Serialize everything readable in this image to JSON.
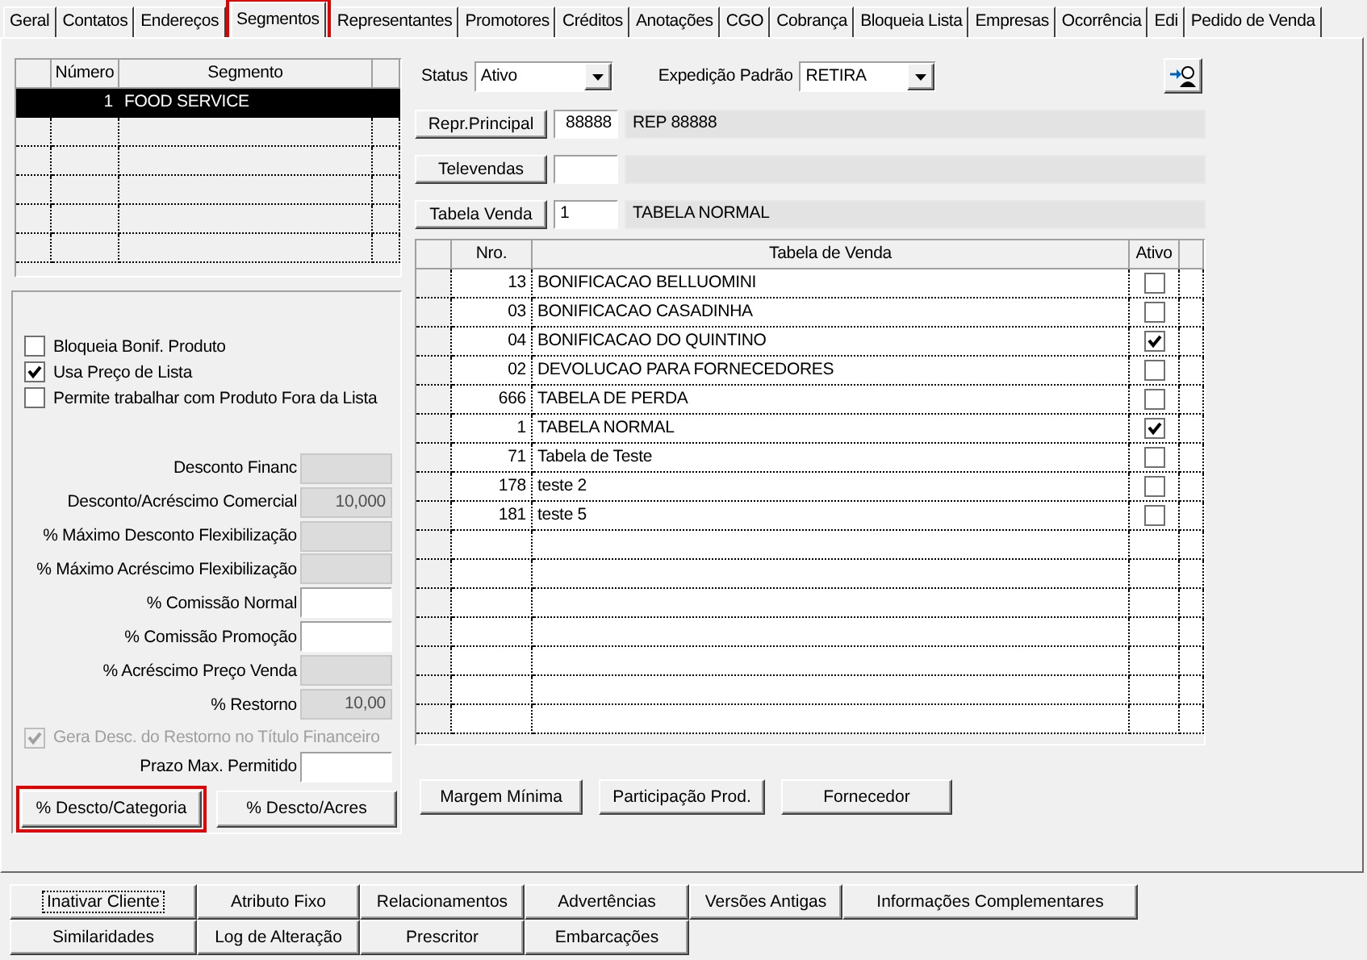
{
  "tabs": [
    {
      "label": "Geral",
      "selected": false,
      "highlighted": false
    },
    {
      "label": "Contatos",
      "selected": false,
      "highlighted": false
    },
    {
      "label": "Endereços",
      "selected": false,
      "highlighted": false
    },
    {
      "label": "Segmentos",
      "selected": true,
      "highlighted": true
    },
    {
      "label": "Representantes",
      "selected": false,
      "highlighted": false
    },
    {
      "label": "Promotores",
      "selected": false,
      "highlighted": false
    },
    {
      "label": "Créditos",
      "selected": false,
      "highlighted": false
    },
    {
      "label": "Anotações",
      "selected": false,
      "highlighted": false
    },
    {
      "label": "CGO",
      "selected": false,
      "highlighted": false
    },
    {
      "label": "Cobrança",
      "selected": false,
      "highlighted": false
    },
    {
      "label": "Bloqueia Lista",
      "selected": false,
      "highlighted": false
    },
    {
      "label": "Empresas",
      "selected": false,
      "highlighted": false
    },
    {
      "label": "Ocorrência",
      "selected": false,
      "highlighted": false
    },
    {
      "label": "Edi",
      "selected": false,
      "highlighted": false
    },
    {
      "label": "Pedido de Venda",
      "selected": false,
      "highlighted": false
    }
  ],
  "segment_grid": {
    "columns": [
      "Número",
      "Segmento"
    ],
    "rows": [
      {
        "numero": "1",
        "segmento": "FOOD SERVICE",
        "selected": true
      }
    ]
  },
  "options": {
    "items": [
      {
        "kind": "checkbox",
        "label": "Bloqueia Bonif. Produto",
        "checked": false,
        "disabled": false
      },
      {
        "kind": "checkbox",
        "label": "Usa Preço de Lista",
        "checked": true,
        "disabled": false
      },
      {
        "kind": "checkbox",
        "label": "Permite trabalhar com Produto Fora da Lista",
        "checked": false,
        "disabled": false
      },
      {
        "kind": "field",
        "label": "Desconto Financ",
        "disabled": true
      },
      {
        "kind": "field",
        "label": "Desconto/Acréscimo Comercial",
        "value": "10,000",
        "disabled": true
      },
      {
        "kind": "field",
        "label": "% Máximo Desconto Flexibilização",
        "disabled": true
      },
      {
        "kind": "field",
        "label": "% Máximo Acréscimo Flexibilização",
        "disabled": true
      },
      {
        "kind": "field",
        "label": "% Comissão Normal",
        "disabled": false
      },
      {
        "kind": "field",
        "label": "% Comissão Promoção",
        "disabled": false
      },
      {
        "kind": "field",
        "label": "% Acréscimo Preço Venda",
        "disabled": true
      },
      {
        "kind": "field",
        "label": "% Restorno",
        "value": "10,00",
        "disabled": true
      },
      {
        "kind": "checkbox",
        "label": "Gera Desc. do Restorno no Título Financeiro",
        "checked": true,
        "disabled": true
      },
      {
        "kind": "field",
        "label": "Prazo Max. Permitido",
        "disabled": false
      }
    ],
    "buttons": [
      {
        "label": "% Descto/Categoria",
        "highlighted": true
      },
      {
        "label": "% Descto/Acres",
        "highlighted": false
      }
    ]
  },
  "status": {
    "label": "Status",
    "value": "Ativo"
  },
  "expedicao": {
    "label": "Expedição Padrão",
    "value": "RETIRA"
  },
  "lookups": [
    {
      "button": "Repr.Principal",
      "code": "88888",
      "description": "REP 88888"
    },
    {
      "button": "Televendas"
    },
    {
      "button": "Tabela Venda",
      "code": "1",
      "description": "TABELA NORMAL"
    }
  ],
  "sales_table": {
    "columns": [
      "Nro.",
      "Tabela de Venda",
      "Ativo"
    ],
    "rows": [
      {
        "nro": "13",
        "name": "BONIFICACAO BELLUOMINI",
        "active": false
      },
      {
        "nro": "03",
        "name": "BONIFICACAO CASADINHA",
        "active": false
      },
      {
        "nro": "04",
        "name": "BONIFICACAO DO QUINTINO",
        "active": true
      },
      {
        "nro": "02",
        "name": "DEVOLUCAO PARA FORNECEDORES",
        "active": false
      },
      {
        "nro": "666",
        "name": "TABELA DE PERDA",
        "active": false
      },
      {
        "nro": "1",
        "name": "TABELA NORMAL",
        "active": true
      },
      {
        "nro": "71",
        "name": "Tabela de Teste",
        "active": false
      },
      {
        "nro": "178",
        "name": "teste 2",
        "active": false
      },
      {
        "nro": "181",
        "name": "teste 5",
        "active": false
      }
    ]
  },
  "action_buttons": [
    "Margem Mínima",
    "Participação Prod.",
    "Fornecedor"
  ],
  "bottom_buttons": [
    [
      {
        "label": "Inativar Cliente",
        "focused": true
      },
      {
        "label": "Atributo Fixo",
        "focused": false
      },
      {
        "label": "Relacionamentos",
        "focused": false
      },
      {
        "label": "Advertências",
        "focused": false
      },
      {
        "label": "Versões Antigas",
        "focused": false
      },
      {
        "label": "Informações Complementares",
        "focused": false
      }
    ],
    [
      {
        "label": "Similaridades",
        "focused": false
      },
      {
        "label": "Log de Alteração",
        "focused": false
      },
      {
        "label": "Prescritor",
        "focused": false
      },
      {
        "label": "Embarcações",
        "focused": false
      }
    ]
  ]
}
